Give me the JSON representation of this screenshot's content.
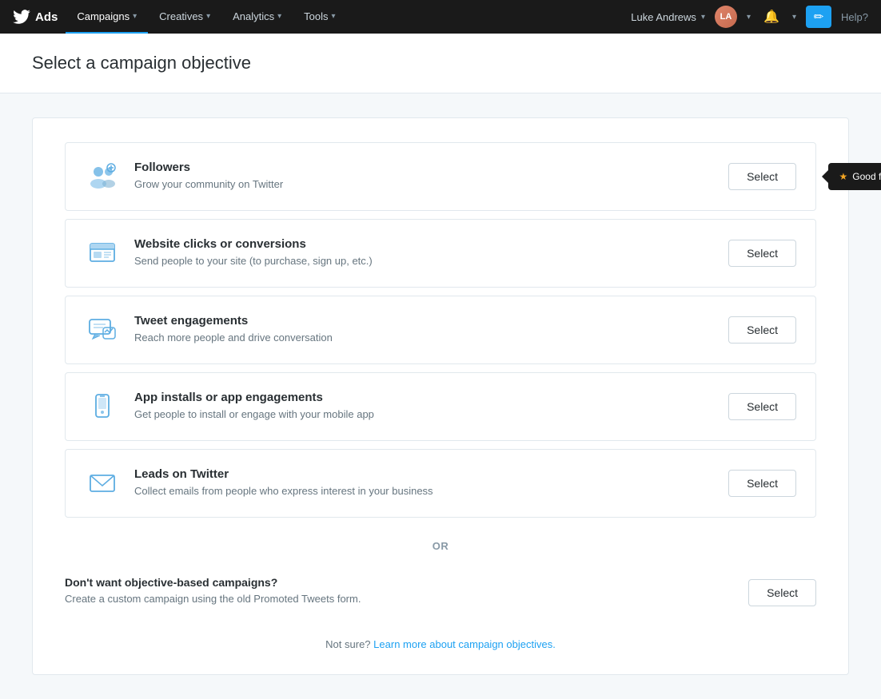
{
  "brand": {
    "logo_alt": "Twitter",
    "name": "Ads"
  },
  "nav": {
    "campaigns_label": "Campaigns",
    "creatives_label": "Creatives",
    "analytics_label": "Analytics",
    "tools_label": "Tools",
    "user_name": "Luke Andrews",
    "help_label": "Help?"
  },
  "page": {
    "title": "Select a campaign objective"
  },
  "objectives": [
    {
      "id": "followers",
      "name": "Followers",
      "desc": "Grow your community on Twitter",
      "select_label": "Select",
      "badge": "Good for new users"
    },
    {
      "id": "website",
      "name": "Website clicks or conversions",
      "desc": "Send people to your site (to purchase, sign up, etc.)",
      "select_label": "Select",
      "badge": null
    },
    {
      "id": "tweet",
      "name": "Tweet engagements",
      "desc": "Reach more people and drive conversation",
      "select_label": "Select",
      "badge": null
    },
    {
      "id": "app",
      "name": "App installs or app engagements",
      "desc": "Get people to install or engage with your mobile app",
      "select_label": "Select",
      "badge": null
    },
    {
      "id": "leads",
      "name": "Leads on Twitter",
      "desc": "Collect emails from people who express interest in your business",
      "select_label": "Select",
      "badge": null
    }
  ],
  "or_divider": "OR",
  "no_objective": {
    "name": "Don't want objective-based campaigns?",
    "desc": "Create a custom campaign using the old Promoted Tweets form.",
    "select_label": "Select"
  },
  "bottom_link": {
    "text": "Not sure?",
    "link_text": "Learn more about campaign objectives.",
    "link_url": "#"
  }
}
